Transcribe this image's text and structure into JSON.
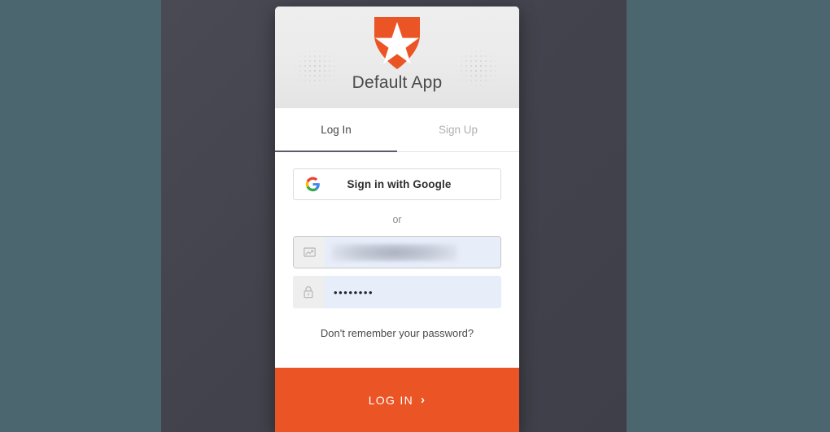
{
  "colors": {
    "outer_background": "#4c6670",
    "page_background": "#45454f",
    "card_background": "#ffffff",
    "header_background": "#ebebeb",
    "brand_orange": "#eb5424",
    "input_background": "#e8edfa",
    "input_icon_background": "#eeeeee",
    "tab_active_text": "#48484a",
    "tab_inactive_text": "#b0b0b0",
    "tab_underline": "#5c5c66",
    "google_red": "#ea4335",
    "google_yellow": "#fbbc05",
    "google_green": "#34a853",
    "google_blue": "#4285f4"
  },
  "header": {
    "app_title": "Default App",
    "logo_icon": "auth0-shield-star-icon",
    "decoration_icon": "dot-pattern-decoration"
  },
  "tabs": [
    {
      "id": "login",
      "label": "Log In",
      "active": true
    },
    {
      "id": "signup",
      "label": "Sign Up",
      "active": false
    }
  ],
  "social": {
    "icon": "google-g-icon",
    "label": "Sign in with Google"
  },
  "separator": {
    "label": "or"
  },
  "fields": [
    {
      "id": "email",
      "icon": "envelope-icon",
      "value": "",
      "placeholder": "",
      "redacted": true,
      "focused": true
    },
    {
      "id": "password",
      "icon": "lock-icon",
      "value": "••••••••",
      "placeholder": "",
      "redacted": false,
      "focused": false
    }
  ],
  "links": {
    "forgot_password": "Don't remember your password?"
  },
  "submit": {
    "label": "LOG IN",
    "chevron": "›",
    "chevron_icon": "chevron-right-icon"
  }
}
